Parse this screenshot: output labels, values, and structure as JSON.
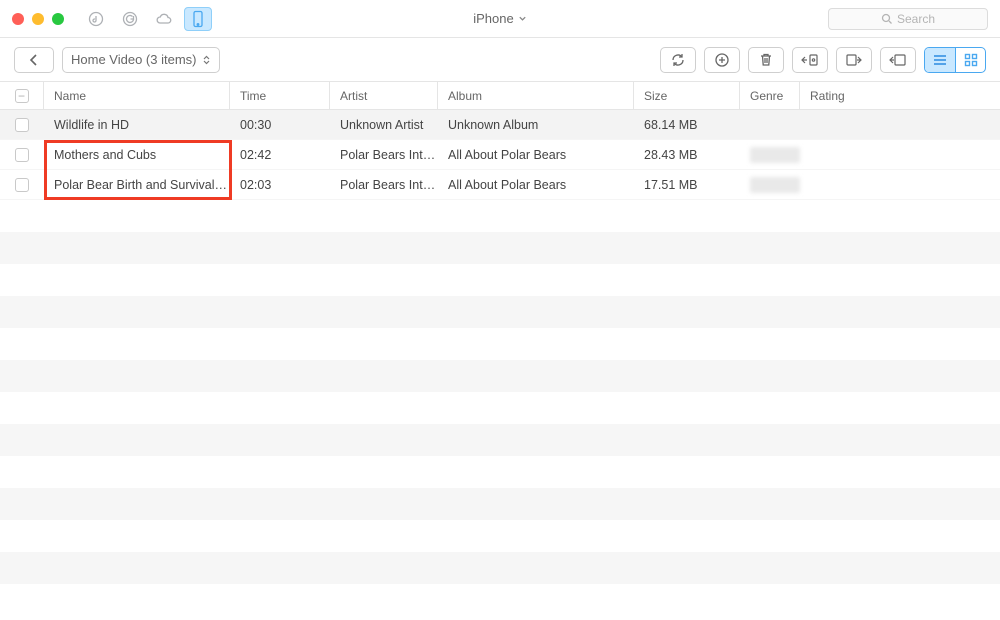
{
  "window": {
    "device_title": "iPhone",
    "search_placeholder": "Search"
  },
  "toolbar": {
    "breadcrumb_label": "Home Video (3 items)"
  },
  "columns": {
    "name": "Name",
    "time": "Time",
    "artist": "Artist",
    "album": "Album",
    "size": "Size",
    "genre": "Genre",
    "rating": "Rating"
  },
  "rows": [
    {
      "name": "Wildlife in HD",
      "time": "00:30",
      "artist": "Unknown Artist",
      "album": "Unknown Album",
      "size": "68.14 MB",
      "genre": "",
      "selected": true
    },
    {
      "name": "Mothers and Cubs",
      "time": "02:42",
      "artist": "Polar Bears Inte…",
      "album": "All About Polar Bears",
      "size": "28.43 MB",
      "genre": "blurred",
      "selected": false
    },
    {
      "name": "Polar Bear Birth and Survival R…",
      "time": "02:03",
      "artist": "Polar Bears Inte…",
      "album": "All About Polar Bears",
      "size": "17.51 MB",
      "genre": "blurred",
      "selected": false
    }
  ]
}
